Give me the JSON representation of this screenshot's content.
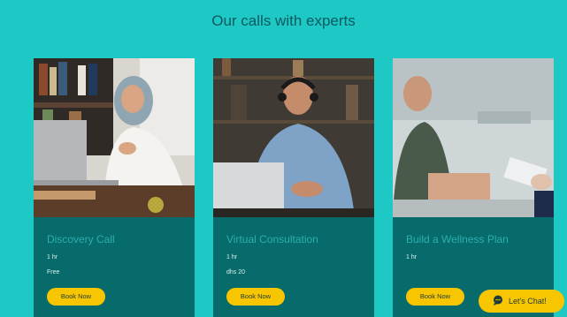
{
  "header": {
    "title": "Our calls with experts"
  },
  "cards": [
    {
      "title": "Discovery Call",
      "duration": "1 hr",
      "price": "Free",
      "button": "Book Now",
      "image": "woman-in-hijab-at-laptop"
    },
    {
      "title": "Virtual Consultation",
      "duration": "1 hr",
      "price": "dhs 20",
      "button": "Book Now",
      "image": "man-with-headset-at-laptop"
    },
    {
      "title": "Build a Wellness Plan",
      "duration": "1 hr",
      "price": "",
      "button": "Book Now",
      "image": "patient-talking-to-counselor"
    }
  ],
  "chat": {
    "label": "Let's Chat!",
    "icon": "chat-bubble-icon"
  },
  "colors": {
    "background": "#1ec8c4",
    "card": "#076a6b",
    "button": "#f7c600",
    "title": "#0a5a5f"
  }
}
